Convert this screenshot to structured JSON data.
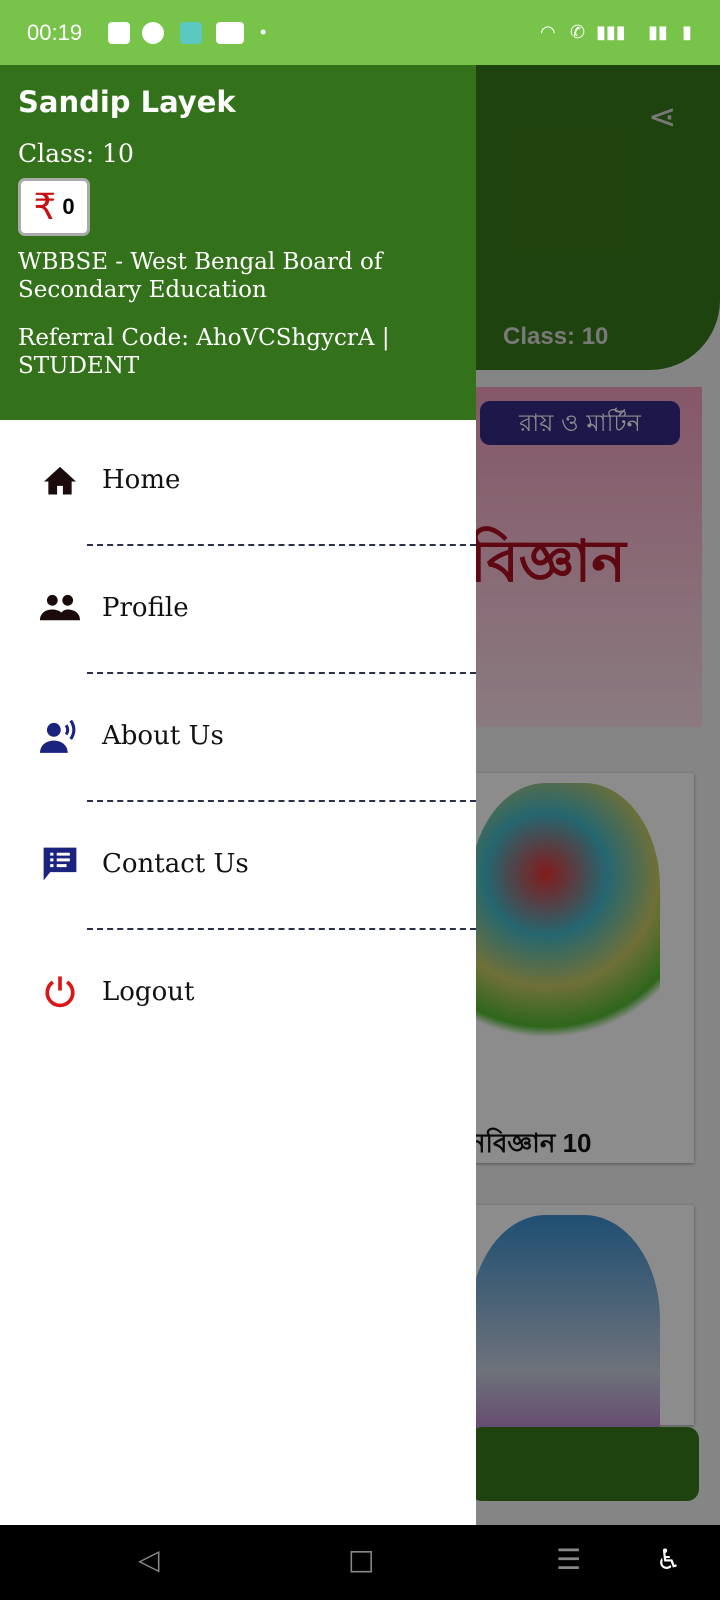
{
  "status_bar": {
    "time": "00:19",
    "icons": [
      "gallery-icon",
      "app-icon",
      "app2-icon",
      "youtube-icon",
      "wifi-icon",
      "wifi-call-icon",
      "roaming-icon",
      "signal-icon",
      "signal2-icon",
      "battery-charging-icon"
    ]
  },
  "background": {
    "class_label": "Class: 10",
    "card_label": "নবিজ্ঞান 10",
    "banner_top": "রায় ও মার্টিন",
    "banner_title": "বিজ্ঞান"
  },
  "drawer": {
    "name": "Sandip Layek",
    "class": "Class: 10",
    "wallet_symbol": "₹",
    "wallet_amount": "0",
    "board": "WBBSE - West Bengal Board of Secondary Education",
    "referral": "Referral Code: AhoVCShgycrA | STUDENT",
    "items": [
      {
        "label": "Home",
        "icon": "home-icon"
      },
      {
        "label": "Profile",
        "icon": "people-icon"
      },
      {
        "label": "About Us",
        "icon": "speaker-person-icon"
      },
      {
        "label": "Contact Us",
        "icon": "message-list-icon"
      },
      {
        "label": "Logout",
        "icon": "power-icon"
      }
    ]
  },
  "colors": {
    "status": "#78c34a",
    "header": "#33711a",
    "logout": "#d81818",
    "icon_dark": "#1a237e"
  }
}
